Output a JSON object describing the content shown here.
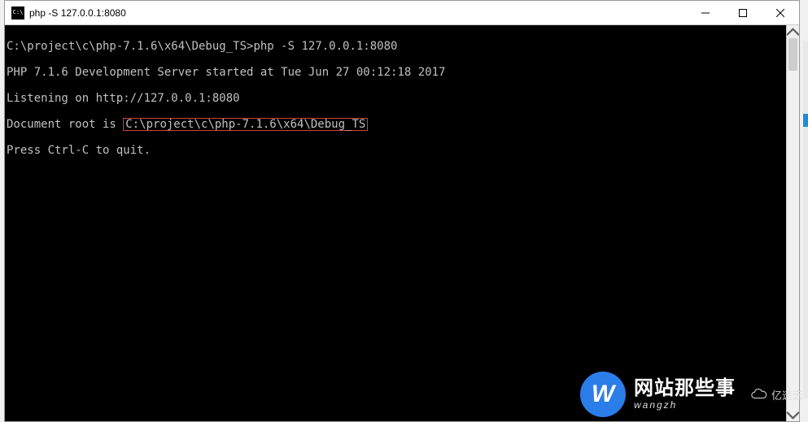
{
  "window": {
    "title": "php  -S 127.0.0.1:8080"
  },
  "console": {
    "prompt_path": "C:\\project\\c\\php-7.1.6\\x64\\Debug_TS>",
    "command": "php -S 127.0.0.1:8080",
    "lines": {
      "server_started": "PHP 7.1.6 Development Server started at Tue Jun 27 00:12:18 2017",
      "listening": "Listening on http://127.0.0.1:8080",
      "docroot_prefix": "Document root is ",
      "docroot_path": "C:\\project\\c\\php-7.1.6\\x64\\Debug_TS",
      "quit": "Press Ctrl-C to quit."
    }
  },
  "watermark": {
    "badge": "W",
    "main": "网站那些事",
    "sub": "wangzh",
    "cloud": "亿速云"
  }
}
